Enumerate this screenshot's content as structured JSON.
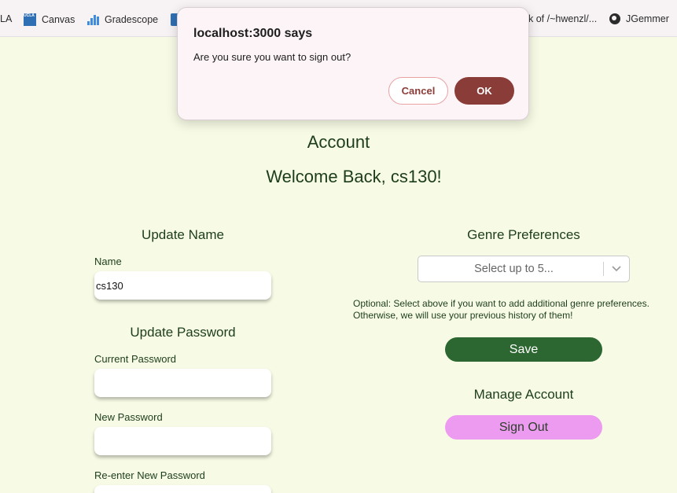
{
  "bookmarks": {
    "items": [
      {
        "label": "LA"
      },
      {
        "label": "Canvas",
        "icon": "canvas-icon"
      },
      {
        "label": "Gradescope",
        "icon": "gradescope-icon"
      },
      {
        "label": "k of /~hwenzl/..."
      },
      {
        "label": "JGemmer",
        "icon": "globe-icon"
      }
    ],
    "canvas_icon_text": "UCLA"
  },
  "page": {
    "title": "Account",
    "welcome": "Welcome Back, cs130!"
  },
  "update_name": {
    "heading": "Update Name",
    "name_label": "Name",
    "name_value": "cs130"
  },
  "update_password": {
    "heading": "Update Password",
    "current_label": "Current Password",
    "new_label": "New Password",
    "reenter_label": "Re-enter New Password"
  },
  "genre": {
    "heading": "Genre Preferences",
    "placeholder": "Select up to 5...",
    "hint": "Optional: Select above if you want to add additional genre preferences. Otherwise, we will use your previous history of them!",
    "save_label": "Save"
  },
  "manage": {
    "heading": "Manage Account",
    "signout_label": "Sign Out"
  },
  "dialog": {
    "title": "localhost:3000 says",
    "message": "Are you sure you want to sign out?",
    "cancel_label": "Cancel",
    "ok_label": "OK"
  },
  "colors": {
    "page_background": "#f7fbe5",
    "text_green": "#1d3d1a",
    "save_button": "#2c6630",
    "signout_button": "#ec9bf0",
    "dialog_ok": "#8a3d38"
  }
}
